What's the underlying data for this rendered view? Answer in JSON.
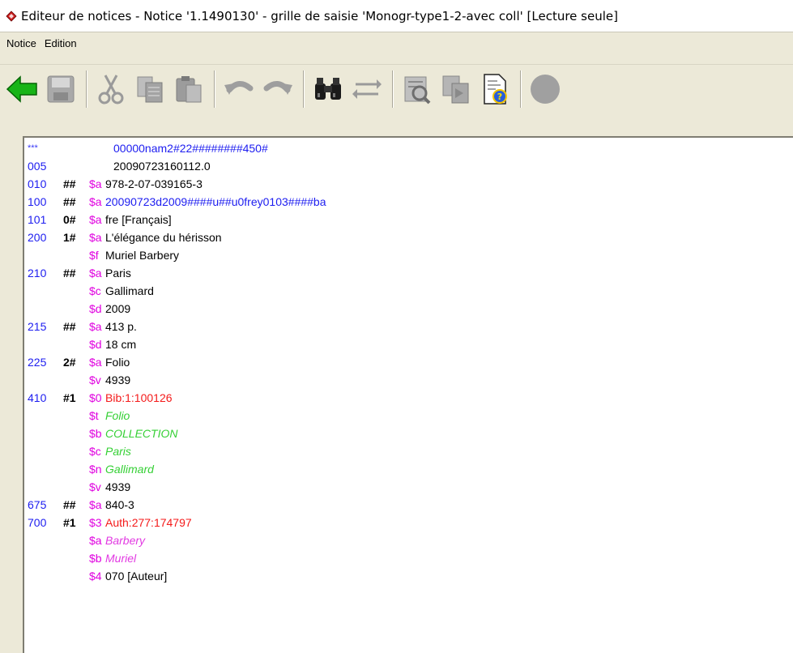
{
  "window": {
    "title": "Editeur de notices - Notice '1.1490130' - grille de saisie 'Monogr-type1-2-avec coll' [Lecture seule]"
  },
  "menu": {
    "items": [
      {
        "label": "Notice"
      },
      {
        "label": "Edition"
      }
    ]
  },
  "toolbar": {
    "buttons": [
      {
        "icon": "back-arrow-icon"
      },
      {
        "icon": "save-icon"
      },
      {
        "icon": "cut-icon"
      },
      {
        "icon": "copy-icon"
      },
      {
        "icon": "paste-icon"
      },
      {
        "icon": "undo-icon"
      },
      {
        "icon": "redo-icon"
      },
      {
        "icon": "find-icon"
      },
      {
        "icon": "replace-icon"
      },
      {
        "icon": "view-icon"
      },
      {
        "icon": "duplicate-icon"
      },
      {
        "icon": "help-document-icon"
      },
      {
        "icon": "status-circle-icon"
      }
    ]
  },
  "record": {
    "leader": {
      "tag": "***",
      "value": "00000nam2#22########450#"
    },
    "lines": [
      {
        "tag": "005",
        "ind": "",
        "code": "",
        "value": "20090723160112.0",
        "style": "blk"
      },
      {
        "tag": "010",
        "ind": "##",
        "code": "$a",
        "value": "978-2-07-039165-3",
        "style": "blk"
      },
      {
        "tag": "100",
        "ind": "##",
        "code": "$a",
        "value": "20090723d2009####u##u0frey0103####ba",
        "style": "blu"
      },
      {
        "tag": "101",
        "ind": "0#",
        "code": "$a",
        "value": "fre [Français]",
        "style": "blk"
      },
      {
        "tag": "200",
        "ind": "1#",
        "code": "$a",
        "value": "L'élégance du hérisson",
        "style": "blk"
      },
      {
        "tag": "",
        "ind": "",
        "code": "$f",
        "value": "Muriel Barbery",
        "style": "blk"
      },
      {
        "tag": "210",
        "ind": "##",
        "code": "$a",
        "value": "Paris",
        "style": "blk"
      },
      {
        "tag": "",
        "ind": "",
        "code": "$c",
        "value": "Gallimard",
        "style": "blk"
      },
      {
        "tag": "",
        "ind": "",
        "code": "$d",
        "value": "2009",
        "style": "blk"
      },
      {
        "tag": "215",
        "ind": "##",
        "code": "$a",
        "value": "413 p.",
        "style": "blk"
      },
      {
        "tag": "",
        "ind": "",
        "code": "$d",
        "value": "18 cm",
        "style": "blk"
      },
      {
        "tag": "225",
        "ind": "2#",
        "code": "$a",
        "value": "Folio",
        "style": "blk"
      },
      {
        "tag": "",
        "ind": "",
        "code": "$v",
        "value": "4939",
        "style": "blk"
      },
      {
        "tag": "410",
        "ind": "#1",
        "code": "$0",
        "value": "Bib:1:100126",
        "style": "red"
      },
      {
        "tag": "",
        "ind": "",
        "code": "$t",
        "value": "Folio",
        "style": "grn"
      },
      {
        "tag": "",
        "ind": "",
        "code": "$b",
        "value": "COLLECTION",
        "style": "grn"
      },
      {
        "tag": "",
        "ind": "",
        "code": "$c",
        "value": "Paris",
        "style": "grn"
      },
      {
        "tag": "",
        "ind": "",
        "code": "$n",
        "value": "Gallimard",
        "style": "grn"
      },
      {
        "tag": "",
        "ind": "",
        "code": "$v",
        "value": "4939",
        "style": "blk"
      },
      {
        "tag": "675",
        "ind": "##",
        "code": "$a",
        "value": "840-3",
        "style": "blk"
      },
      {
        "tag": "700",
        "ind": "#1",
        "code": "$3",
        "value": "Auth:277:174797",
        "style": "red"
      },
      {
        "tag": "",
        "ind": "",
        "code": "$a",
        "value": "Barbery",
        "style": "mag"
      },
      {
        "tag": "",
        "ind": "",
        "code": "$b",
        "value": "Muriel",
        "style": "mag"
      },
      {
        "tag": "",
        "ind": "",
        "code": "$4",
        "value": "070 [Auteur]",
        "style": "blk"
      }
    ]
  }
}
